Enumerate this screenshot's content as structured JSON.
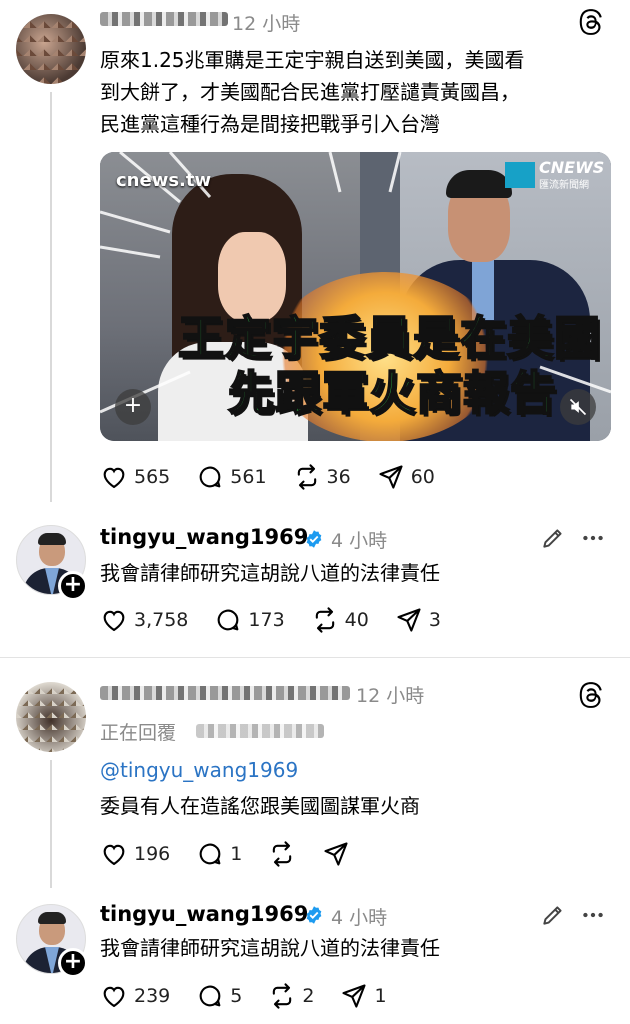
{
  "post1": {
    "time": "12 小時",
    "text_lines": [
      "原來1.25兆軍購是王定宇親自送到美國，美國看",
      "到大餅了，才美國配合民進黨打壓譴責黃國昌，",
      "民進黨這種行為是間接把戰爭引入台灣"
    ],
    "media": {
      "watermark": "cnews.tw",
      "brand": "CNEWS",
      "brand_sub": "匯流新聞網",
      "caption_line1": "王定宇委員是在美國",
      "caption_line2": "先跟軍火商報告"
    },
    "likes": "565",
    "replies": "561",
    "reposts": "36",
    "shares": "60"
  },
  "reply1": {
    "username": "tingyu_wang1969",
    "time": "4 小時",
    "text": "我會請律師研究這胡說八道的法律責任",
    "likes": "3,758",
    "replies": "173",
    "reposts": "40",
    "shares": "3"
  },
  "post2": {
    "time": "12 小時",
    "replying_to": "正在回覆",
    "mention": "@tingyu_wang1969",
    "text": "委員有人在造謠您跟美國圖謀軍火商",
    "likes": "196",
    "replies": "1"
  },
  "reply2": {
    "username": "tingyu_wang1969",
    "time": "4 小時",
    "text": "我會請律師研究這胡說八道的法律責任",
    "likes": "239",
    "replies": "5",
    "reposts": "2",
    "shares": "1"
  },
  "colors": {
    "verified": "#1d9bf0",
    "mention": "#2b74c4",
    "caption": "#2fc24a"
  }
}
